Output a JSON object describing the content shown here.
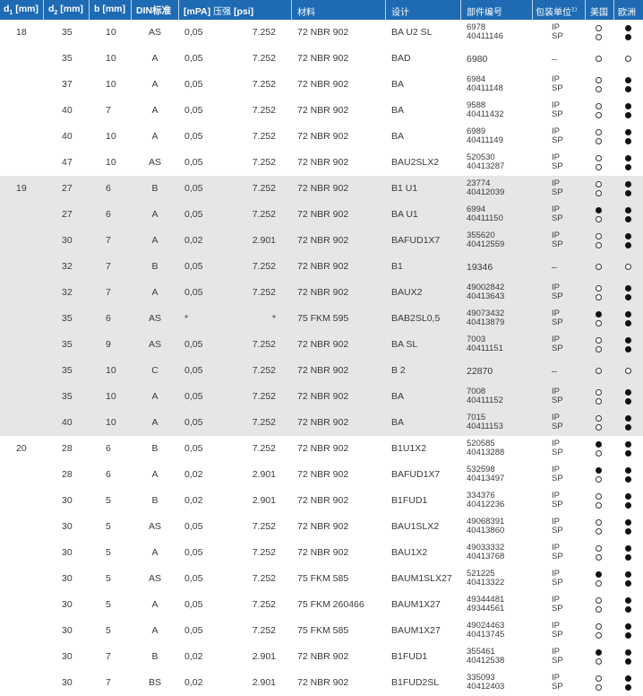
{
  "header": {
    "d1": "d",
    "d1_sub": "1",
    "d1_unit": "[mm]",
    "d2": "d",
    "d2_sub": "2",
    "d2_unit": "[mm]",
    "b": "b [mm]",
    "din": "DIN标准",
    "pressure_mpa": "[mPA]",
    "pressure_cn": "压强",
    "pressure_psi": "[psi]",
    "material": "材料",
    "design": "设计",
    "part_no": "部件编号",
    "package": "包装单位",
    "package_sup": "1)",
    "usa": "美国",
    "europe": "欧洲"
  },
  "rows": [
    {
      "d1": "18",
      "d2": "35",
      "b": "10",
      "din": "AS",
      "mpa": "0,05",
      "psi": "7.252",
      "material": "72 NBR 902",
      "design": "BA U2 SL",
      "part": [
        "6978",
        "40411146"
      ],
      "pack": [
        "IP",
        "SP"
      ],
      "usa": [
        "open",
        "open"
      ],
      "eu": [
        "filled",
        "filled"
      ],
      "shaded": false
    },
    {
      "d1": "",
      "d2": "35",
      "b": "10",
      "din": "A",
      "mpa": "0,05",
      "psi": "7.252",
      "material": "72 NBR 902",
      "design": "BAD",
      "part": [
        "6980"
      ],
      "pack": [
        "–"
      ],
      "usa": [
        "open"
      ],
      "eu": [
        "open"
      ],
      "shaded": false
    },
    {
      "d1": "",
      "d2": "37",
      "b": "10",
      "din": "A",
      "mpa": "0,05",
      "psi": "7.252",
      "material": "72 NBR 902",
      "design": "BA",
      "part": [
        "6984",
        "40411148"
      ],
      "pack": [
        "IP",
        "SP"
      ],
      "usa": [
        "open",
        "open"
      ],
      "eu": [
        "filled",
        "filled"
      ],
      "shaded": false
    },
    {
      "d1": "",
      "d2": "40",
      "b": "7",
      "din": "A",
      "mpa": "0,05",
      "psi": "7.252",
      "material": "72 NBR 902",
      "design": "BA",
      "part": [
        "9588",
        "40411432"
      ],
      "pack": [
        "IP",
        "SP"
      ],
      "usa": [
        "open",
        "open"
      ],
      "eu": [
        "filled",
        "filled"
      ],
      "shaded": false
    },
    {
      "d1": "",
      "d2": "40",
      "b": "10",
      "din": "A",
      "mpa": "0,05",
      "psi": "7.252",
      "material": "72 NBR 902",
      "design": "BA",
      "part": [
        "6989",
        "40411149"
      ],
      "pack": [
        "IP",
        "SP"
      ],
      "usa": [
        "open",
        "open"
      ],
      "eu": [
        "filled",
        "filled"
      ],
      "shaded": false
    },
    {
      "d1": "",
      "d2": "47",
      "b": "10",
      "din": "AS",
      "mpa": "0,05",
      "psi": "7.252",
      "material": "72 NBR 902",
      "design": "BAU2SLX2",
      "part": [
        "520530",
        "40413287"
      ],
      "pack": [
        "IP",
        "SP"
      ],
      "usa": [
        "open",
        "open"
      ],
      "eu": [
        "filled",
        "filled"
      ],
      "shaded": false
    },
    {
      "d1": "19",
      "d2": "27",
      "b": "6",
      "din": "B",
      "mpa": "0,05",
      "psi": "7.252",
      "material": "72 NBR 902",
      "design": "B1 U1",
      "part": [
        "23774",
        "40412039"
      ],
      "pack": [
        "IP",
        "SP"
      ],
      "usa": [
        "open",
        "open"
      ],
      "eu": [
        "filled",
        "filled"
      ],
      "shaded": true
    },
    {
      "d1": "",
      "d2": "27",
      "b": "6",
      "din": "A",
      "mpa": "0,05",
      "psi": "7.252",
      "material": "72 NBR 902",
      "design": "BA U1",
      "part": [
        "6994",
        "40411150"
      ],
      "pack": [
        "IP",
        "SP"
      ],
      "usa": [
        "filled",
        "open"
      ],
      "eu": [
        "filled",
        "filled"
      ],
      "shaded": true
    },
    {
      "d1": "",
      "d2": "30",
      "b": "7",
      "din": "A",
      "mpa": "0,02",
      "psi": "2.901",
      "material": "72 NBR 902",
      "design": "BAFUD1X7",
      "part": [
        "355620",
        "40412559"
      ],
      "pack": [
        "IP",
        "SP"
      ],
      "usa": [
        "open",
        "open"
      ],
      "eu": [
        "filled",
        "filled"
      ],
      "shaded": true
    },
    {
      "d1": "",
      "d2": "32",
      "b": "7",
      "din": "B",
      "mpa": "0,05",
      "psi": "7.252",
      "material": "72 NBR 902",
      "design": "B1",
      "part": [
        "19346"
      ],
      "pack": [
        "–"
      ],
      "usa": [
        "open"
      ],
      "eu": [
        "open"
      ],
      "shaded": true
    },
    {
      "d1": "",
      "d2": "32",
      "b": "7",
      "din": "A",
      "mpa": "0,05",
      "psi": "7.252",
      "material": "72 NBR 902",
      "design": "BAUX2",
      "part": [
        "49002842",
        "40413643"
      ],
      "pack": [
        "IP",
        "SP"
      ],
      "usa": [
        "open",
        "open"
      ],
      "eu": [
        "filled",
        "filled"
      ],
      "shaded": true
    },
    {
      "d1": "",
      "d2": "35",
      "b": "6",
      "din": "AS",
      "mpa": "*",
      "psi": "*",
      "material": "75 FKM 595",
      "design": "BAB2SL0,5",
      "part": [
        "49073432",
        "40413879"
      ],
      "pack": [
        "IP",
        "SP"
      ],
      "usa": [
        "filled",
        "open"
      ],
      "eu": [
        "filled",
        "filled"
      ],
      "shaded": true
    },
    {
      "d1": "",
      "d2": "35",
      "b": "9",
      "din": "AS",
      "mpa": "0,05",
      "psi": "7.252",
      "material": "72 NBR 902",
      "design": "BA SL",
      "part": [
        "7003",
        "40411151"
      ],
      "pack": [
        "IP",
        "SP"
      ],
      "usa": [
        "open",
        "open"
      ],
      "eu": [
        "filled",
        "filled"
      ],
      "shaded": true
    },
    {
      "d1": "",
      "d2": "35",
      "b": "10",
      "din": "C",
      "mpa": "0,05",
      "psi": "7.252",
      "material": "72 NBR 902",
      "design": "B 2",
      "part": [
        "22870"
      ],
      "pack": [
        "–"
      ],
      "usa": [
        "open"
      ],
      "eu": [
        "open"
      ],
      "shaded": true
    },
    {
      "d1": "",
      "d2": "35",
      "b": "10",
      "din": "A",
      "mpa": "0,05",
      "psi": "7.252",
      "material": "72 NBR 902",
      "design": "BA",
      "part": [
        "7008",
        "40411152"
      ],
      "pack": [
        "IP",
        "SP"
      ],
      "usa": [
        "open",
        "open"
      ],
      "eu": [
        "filled",
        "filled"
      ],
      "shaded": true
    },
    {
      "d1": "",
      "d2": "40",
      "b": "10",
      "din": "A",
      "mpa": "0,05",
      "psi": "7.252",
      "material": "72 NBR 902",
      "design": "BA",
      "part": [
        "7015",
        "40411153"
      ],
      "pack": [
        "IP",
        "SP"
      ],
      "usa": [
        "open",
        "open"
      ],
      "eu": [
        "filled",
        "filled"
      ],
      "shaded": true
    },
    {
      "d1": "20",
      "d2": "28",
      "b": "6",
      "din": "B",
      "mpa": "0,05",
      "psi": "7.252",
      "material": "72 NBR 902",
      "design": "B1U1X2",
      "part": [
        "520585",
        "40413288"
      ],
      "pack": [
        "IP",
        "SP"
      ],
      "usa": [
        "filled",
        "open"
      ],
      "eu": [
        "filled",
        "filled"
      ],
      "shaded": false
    },
    {
      "d1": "",
      "d2": "28",
      "b": "6",
      "din": "A",
      "mpa": "0,02",
      "psi": "2.901",
      "material": "72 NBR 902",
      "design": "BAFUD1X7",
      "part": [
        "532598",
        "40413497"
      ],
      "pack": [
        "IP",
        "SP"
      ],
      "usa": [
        "filled",
        "open"
      ],
      "eu": [
        "filled",
        "filled"
      ],
      "shaded": false
    },
    {
      "d1": "",
      "d2": "30",
      "b": "5",
      "din": "B",
      "mpa": "0,02",
      "psi": "2.901",
      "material": "72 NBR 902",
      "design": "B1FUD1",
      "part": [
        "334376",
        "40412236"
      ],
      "pack": [
        "IP",
        "SP"
      ],
      "usa": [
        "open",
        "open"
      ],
      "eu": [
        "filled",
        "filled"
      ],
      "shaded": false
    },
    {
      "d1": "",
      "d2": "30",
      "b": "5",
      "din": "AS",
      "mpa": "0,05",
      "psi": "7.252",
      "material": "72 NBR 902",
      "design": "BAU1SLX2",
      "part": [
        "49068391",
        "40413860"
      ],
      "pack": [
        "IP",
        "SP"
      ],
      "usa": [
        "open",
        "open"
      ],
      "eu": [
        "filled",
        "filled"
      ],
      "shaded": false
    },
    {
      "d1": "",
      "d2": "30",
      "b": "5",
      "din": "A",
      "mpa": "0,05",
      "psi": "7.252",
      "material": "72 NBR 902",
      "design": "BAU1X2",
      "part": [
        "49033332",
        "40413768"
      ],
      "pack": [
        "IP",
        "SP"
      ],
      "usa": [
        "open",
        "open"
      ],
      "eu": [
        "filled",
        "filled"
      ],
      "shaded": false
    },
    {
      "d1": "",
      "d2": "30",
      "b": "5",
      "din": "AS",
      "mpa": "0,05",
      "psi": "7.252",
      "material": "75 FKM 585",
      "design": "BAUM1SLX27",
      "part": [
        "521225",
        "40413322"
      ],
      "pack": [
        "IP",
        "SP"
      ],
      "usa": [
        "filled",
        "open"
      ],
      "eu": [
        "filled",
        "filled"
      ],
      "shaded": false
    },
    {
      "d1": "",
      "d2": "30",
      "b": "5",
      "din": "A",
      "mpa": "0,05",
      "psi": "7.252",
      "material": "75 FKM 260466",
      "design": "BAUM1X27",
      "part": [
        "49344481",
        "49344561"
      ],
      "pack": [
        "IP",
        "SP"
      ],
      "usa": [
        "open",
        "open"
      ],
      "eu": [
        "filled",
        "filled"
      ],
      "shaded": false
    },
    {
      "d1": "",
      "d2": "30",
      "b": "5",
      "din": "A",
      "mpa": "0,05",
      "psi": "7.252",
      "material": "75 FKM 585",
      "design": "BAUM1X27",
      "part": [
        "49024463",
        "40413745"
      ],
      "pack": [
        "IP",
        "SP"
      ],
      "usa": [
        "open",
        "open"
      ],
      "eu": [
        "filled",
        "filled"
      ],
      "shaded": false
    },
    {
      "d1": "",
      "d2": "30",
      "b": "7",
      "din": "B",
      "mpa": "0,02",
      "psi": "2.901",
      "material": "72 NBR 902",
      "design": "B1FUD1",
      "part": [
        "355461",
        "40412538"
      ],
      "pack": [
        "IP",
        "SP"
      ],
      "usa": [
        "filled",
        "open"
      ],
      "eu": [
        "filled",
        "filled"
      ],
      "shaded": false
    },
    {
      "d1": "",
      "d2": "30",
      "b": "7",
      "din": "BS",
      "mpa": "0,02",
      "psi": "2.901",
      "material": "72 NBR 902",
      "design": "B1FUD2SL",
      "part": [
        "335093",
        "40412403"
      ],
      "pack": [
        "IP",
        "SP"
      ],
      "usa": [
        "open",
        "open"
      ],
      "eu": [
        "filled",
        "filled"
      ],
      "shaded": false
    }
  ]
}
